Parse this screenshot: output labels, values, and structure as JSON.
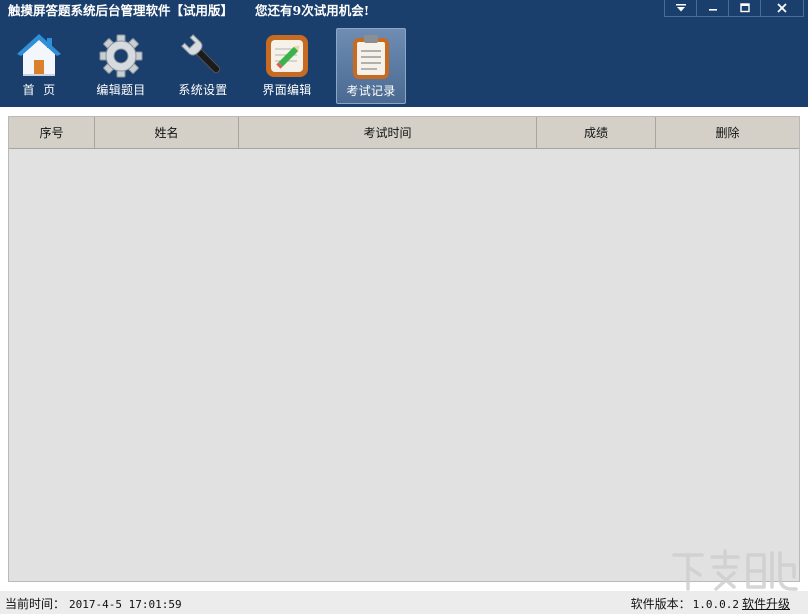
{
  "window": {
    "title": "触摸屏答题系统后台管理软件【试用版】",
    "trial_notice": "您还有9次试用机会!"
  },
  "toolbar": {
    "items": [
      {
        "label": "首  页",
        "icon": "home-icon"
      },
      {
        "label": "编辑题目",
        "icon": "gear-icon"
      },
      {
        "label": "系统设置",
        "icon": "wrench-icon"
      },
      {
        "label": "界面编辑",
        "icon": "edit-pencil-icon"
      },
      {
        "label": "考试记录",
        "icon": "clipboard-icon",
        "active": true
      }
    ]
  },
  "table": {
    "columns": [
      "序号",
      "姓名",
      "考试时间",
      "成绩",
      "删除"
    ],
    "rows": []
  },
  "statusbar": {
    "time_label": "当前时间：",
    "time_value": "2017-4-5 17:01:59",
    "version_label": "软件版本：",
    "version_value": "1.0.0.2",
    "upgrade_label": "软件升级"
  },
  "colors": {
    "header_bg": "#1a3f6c",
    "active_tool_bg": "#5e7ca3",
    "table_bg": "#e1e1e1",
    "table_header_bg": "#d4d0c8"
  }
}
